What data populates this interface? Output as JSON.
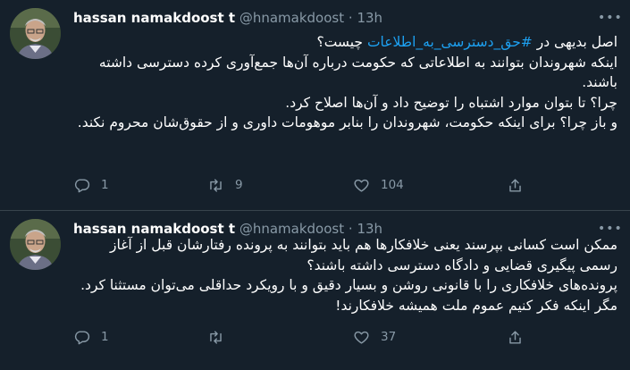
{
  "tweets": [
    {
      "author_name": "hassan namakdoost t",
      "handle": "@hnamakdoost",
      "separator": "·",
      "time": "13h",
      "text_prefix": "اصل بدیهی در ",
      "hashtag": "#حق_دسترسی_به_اطلاعات",
      "text_suffix": " چیست؟",
      "lines": [
        "اینکه شهروندان بتوانند به اطلاعاتی که حکومت درباره آن‌ها جمع‌آوری کرده دسترسی داشته باشند.",
        "چرا؟ تا بتوان موارد اشتباه را توضیح داد و آن‌ها اصلاح کرد.",
        "و باز چرا؟ برای اینکه حکومت، شهروندان را بنابر موهومات داوری و از حقوق‌شان محروم نکند."
      ],
      "replies": "1",
      "retweets": "9",
      "likes": "104"
    },
    {
      "author_name": "hassan namakdoost t",
      "handle": "@hnamakdoost",
      "separator": "·",
      "time": "13h",
      "lines": [
        "ممکن است کسانی بپرسند یعنی خلافکارها هم باید بتوانند به پرونده رفتارشان قبل از آغاز رسمی پیگیری قضایی و دادگاه دسترسی داشته باشند؟",
        "پرونده‌های خلافکاری را با قانونی روشن و بسیار دقیق و با رویکرد حداقلی می‌توان مستثنا کرد. مگر اینکه فکر کنیم عموم ملت همیشه خلافکارند!"
      ],
      "replies": "1",
      "retweets": "",
      "likes": "37"
    }
  ],
  "icons": {
    "reply": "reply-icon",
    "retweet": "retweet-icon",
    "like": "heart-icon",
    "share": "share-icon",
    "more": "more-icon"
  },
  "colors": {
    "background": "#15202b",
    "text": "#ffffff",
    "secondary": "#8899a6",
    "link": "#1da1f2",
    "divider": "#38444d"
  }
}
